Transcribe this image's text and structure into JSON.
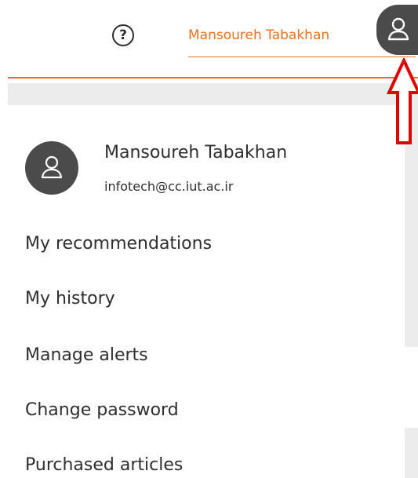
{
  "header": {
    "help_label": "?",
    "user_name_link": "Mansoureh Tabakhan",
    "accent_color": "#e9711c",
    "help_icon": "question-circle-icon",
    "avatar_icon": "user-icon"
  },
  "user_menu": {
    "name": "Mansoureh Tabakhan",
    "email": "infotech@cc.iut.ac.ir",
    "avatar_icon": "user-icon",
    "items": [
      {
        "label": "My recommendations"
      },
      {
        "label": "My history"
      },
      {
        "label": "Manage alerts"
      },
      {
        "label": "Change password"
      },
      {
        "label": "Purchased articles"
      }
    ]
  },
  "annotation": {
    "icon": "arrow-up-icon",
    "color": "#e00000"
  }
}
